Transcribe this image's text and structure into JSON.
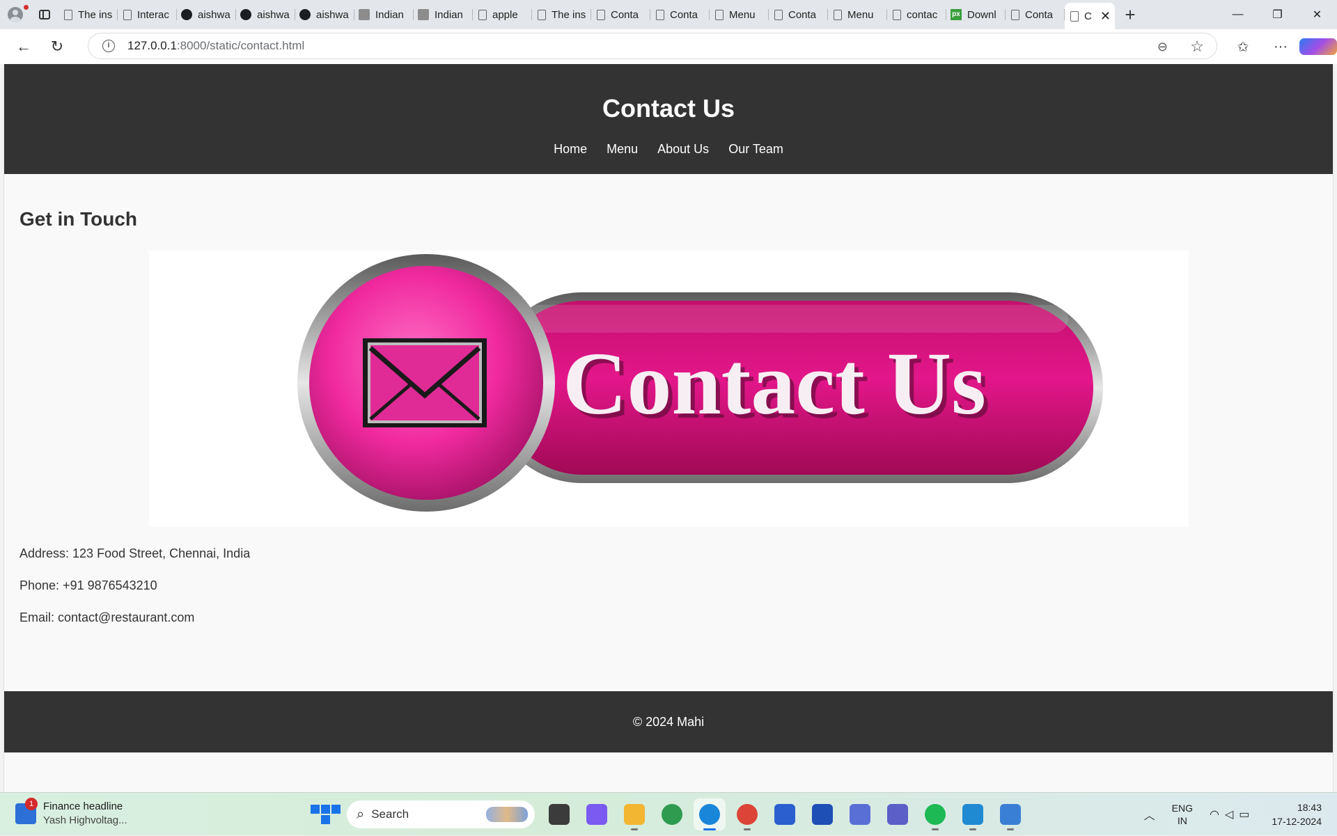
{
  "browser": {
    "tabs": [
      {
        "icon": "doc-icon",
        "label": "The ins"
      },
      {
        "icon": "doc-icon",
        "label": "Interac"
      },
      {
        "icon": "github-icon",
        "label": "aishwa"
      },
      {
        "icon": "github-icon",
        "label": "aishwa"
      },
      {
        "icon": "github-icon",
        "label": "aishwa"
      },
      {
        "icon": "image-icon",
        "label": "Indian"
      },
      {
        "icon": "image-icon",
        "label": "Indian"
      },
      {
        "icon": "doc-icon",
        "label": "apple"
      },
      {
        "icon": "doc-icon",
        "label": "The ins"
      },
      {
        "icon": "doc-icon",
        "label": "Conta"
      },
      {
        "icon": "doc-icon",
        "label": "Conta"
      },
      {
        "icon": "doc-icon",
        "label": "Menu"
      },
      {
        "icon": "doc-icon",
        "label": "Conta"
      },
      {
        "icon": "doc-icon",
        "label": "Menu"
      },
      {
        "icon": "doc-icon",
        "label": "contac"
      },
      {
        "icon": "pixabay-icon",
        "label": "Downl"
      },
      {
        "icon": "doc-icon",
        "label": "Conta"
      }
    ],
    "active_tab": {
      "label": "C",
      "close": "✕"
    },
    "new_tab": "+",
    "window_controls": {
      "minimize": "—",
      "restore": "❐",
      "close": "✕"
    },
    "url_host": "127.0.0.1",
    "url_path": ":8000/static/contact.html"
  },
  "site": {
    "title": "Contact Us",
    "nav": [
      "Home",
      "Menu",
      "About Us",
      "Our Team"
    ],
    "heading": "Get in Touch",
    "banner_text": "Contact Us",
    "address": "Address: 123 Food Street, Chennai, India",
    "phone": "Phone: +91 9876543210",
    "email": "Email: contact@restaurant.com",
    "footer": "© 2024 Mahi",
    "colors": {
      "header_bg": "#333333",
      "banner_pink": "#e0137f"
    }
  },
  "taskbar": {
    "widget_title": "Finance headline",
    "widget_sub": "Yash Highvoltag...",
    "widget_badge": "1",
    "search_placeholder": "Search",
    "apps": [
      {
        "name": "task-view-icon",
        "color": "#3b3b3b"
      },
      {
        "name": "copilot-icon",
        "color": "#7a5af0"
      },
      {
        "name": "file-explorer-icon",
        "color": "#f2b632"
      },
      {
        "name": "edge-beta-icon",
        "color": "#2e9b4f"
      },
      {
        "name": "edge-icon",
        "color": "#1a86d9"
      },
      {
        "name": "chrome-icon",
        "color": "#db4437"
      },
      {
        "name": "store-icon",
        "color": "#2b5fcf"
      },
      {
        "name": "l-app-icon",
        "color": "#1e4fb4"
      },
      {
        "name": "arc-icon",
        "color": "#5a6fd6"
      },
      {
        "name": "teams-icon",
        "color": "#5b5fc7"
      },
      {
        "name": "spotify-icon",
        "color": "#1db954"
      },
      {
        "name": "vscode-icon",
        "color": "#1f8ad2"
      },
      {
        "name": "notepad-icon",
        "color": "#3a7fd6"
      }
    ],
    "lang_top": "ENG",
    "lang_bottom": "IN",
    "time": "18:43",
    "date": "17-12-2024"
  }
}
